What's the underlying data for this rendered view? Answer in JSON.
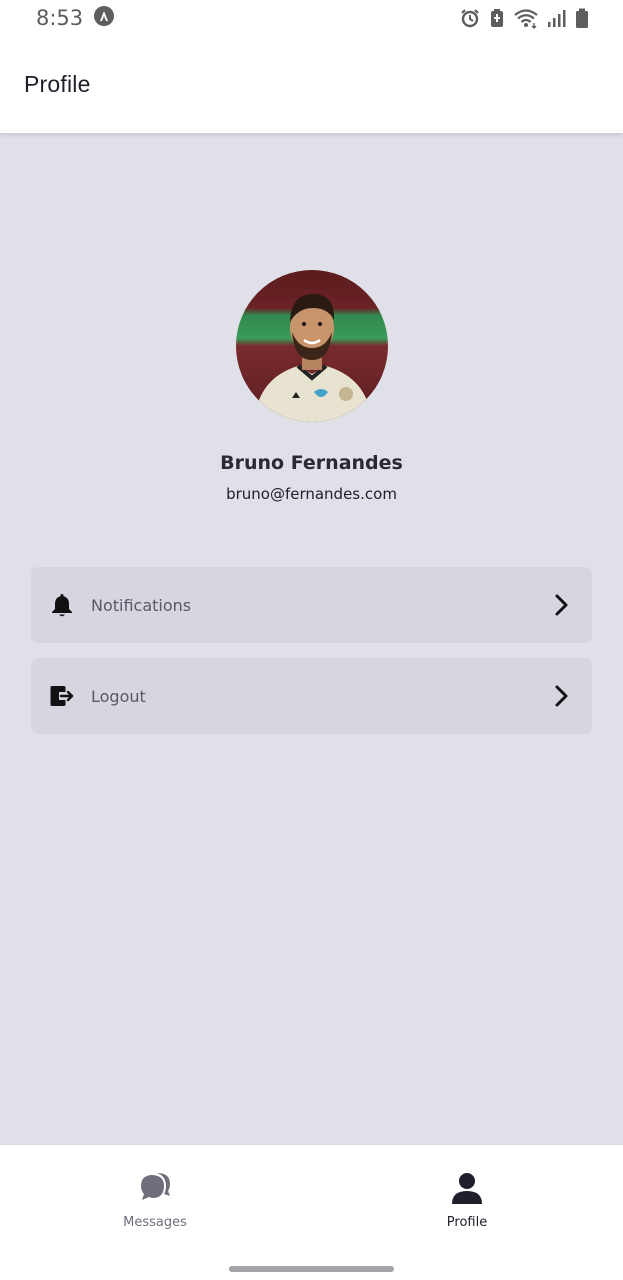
{
  "status_bar": {
    "time": "8:53",
    "icons": [
      "app-notification-icon",
      "alarm-icon",
      "battery-saver-icon",
      "wifi-icon",
      "signal-icon",
      "battery-icon"
    ]
  },
  "app_bar": {
    "title": "Profile"
  },
  "profile": {
    "name": "Bruno Fernandes",
    "email": "bruno@fernandes.com",
    "avatar": "avatar-photo"
  },
  "menu": {
    "items": [
      {
        "label": "Notifications",
        "icon": "bell-icon"
      },
      {
        "label": "Logout",
        "icon": "logout-icon"
      }
    ]
  },
  "bottom_nav": {
    "items": [
      {
        "label": "Messages",
        "icon": "chat-bubbles-icon",
        "active": false
      },
      {
        "label": "Profile",
        "icon": "person-icon",
        "active": true
      }
    ]
  },
  "colors": {
    "background": "#e0e0e8",
    "card": "#d6d6e0",
    "text_primary": "#1f1e2b",
    "text_secondary": "#595866",
    "nav_inactive": "#6f6e7a"
  }
}
